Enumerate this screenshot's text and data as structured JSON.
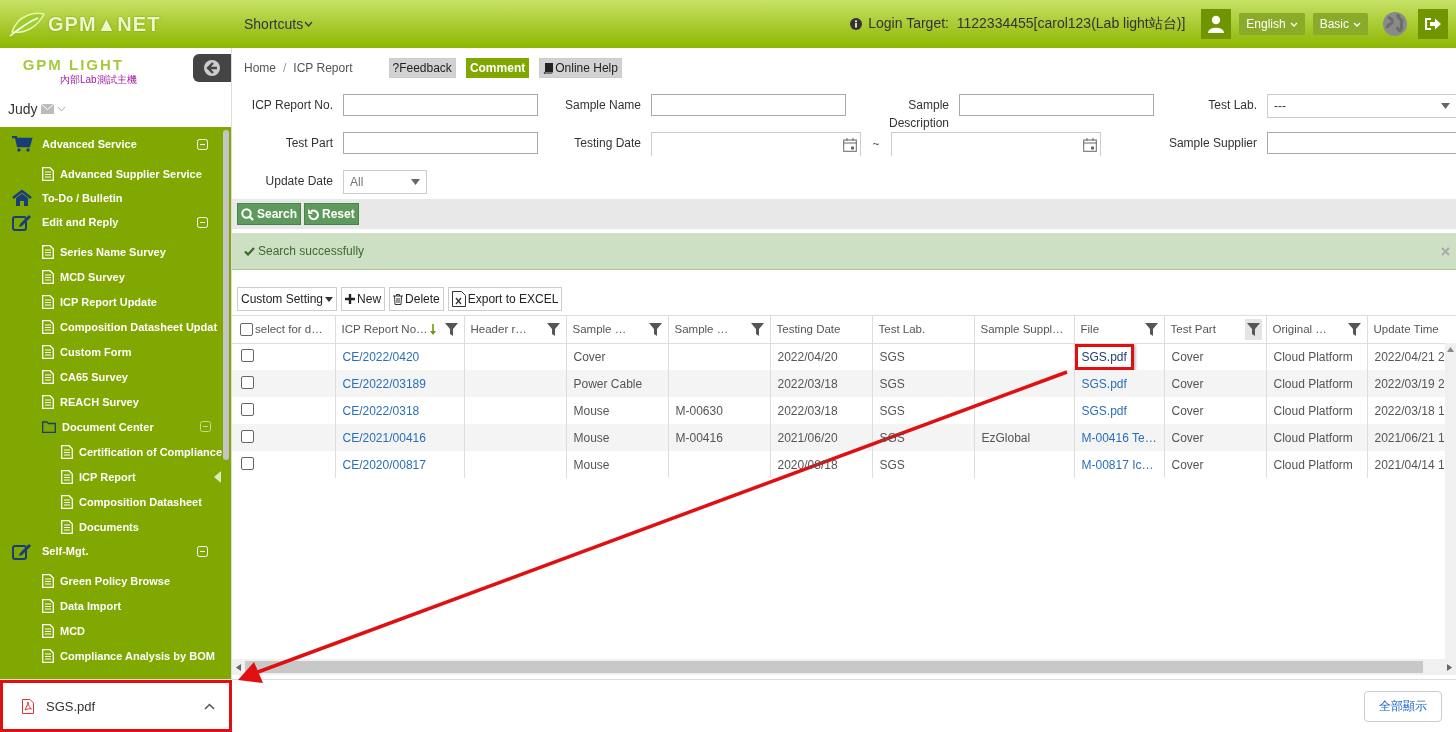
{
  "header": {
    "logo": "GPM▲NET",
    "shortcuts": "Shortcuts",
    "login_target": "Login Target:  1122334455[carol123(Lab light站台)]",
    "language": "English",
    "mode": "Basic"
  },
  "sidebar": {
    "logo": "GPM LIGHT",
    "logo_subtitle": "內部Lab測試主機",
    "user": "Judy",
    "items": [
      {
        "label": "Advanced Service",
        "kind": "section",
        "expanded": true,
        "children": [
          {
            "label": "Advanced Supplier Service",
            "kind": "page",
            "selected": false
          }
        ]
      },
      {
        "label": "To-Do / Bulletin",
        "kind": "section"
      },
      {
        "label": "Edit and Reply",
        "kind": "section",
        "expanded": true,
        "children": [
          {
            "label": "Series Name Survey",
            "kind": "page",
            "selected": false
          },
          {
            "label": "MCD Survey",
            "kind": "page",
            "selected": false
          },
          {
            "label": "ICP Report Update",
            "kind": "page",
            "selected": false
          },
          {
            "label": "Composition Datasheet Updat",
            "kind": "page",
            "selected": false
          },
          {
            "label": "Custom Form",
            "kind": "page",
            "selected": false
          },
          {
            "label": "CA65 Survey",
            "kind": "page",
            "selected": false
          },
          {
            "label": "REACH Survey",
            "kind": "page",
            "selected": false
          },
          {
            "label": "Document Center",
            "kind": "folder",
            "expanded": true,
            "children": [
              {
                "label": "Certification of Compliance",
                "kind": "page",
                "selected": false
              },
              {
                "label": "ICP Report",
                "kind": "page",
                "selected": true
              },
              {
                "label": "Composition Datasheet",
                "kind": "page",
                "selected": false
              },
              {
                "label": "Documents",
                "kind": "page",
                "selected": false
              }
            ]
          }
        ]
      },
      {
        "label": "Self-Mgt.",
        "kind": "section",
        "expanded": true,
        "children": [
          {
            "label": "Green Policy Browse",
            "kind": "page",
            "selected": false
          },
          {
            "label": "Data Import",
            "kind": "page",
            "selected": false
          },
          {
            "label": "MCD",
            "kind": "page",
            "selected": false
          },
          {
            "label": "Compliance Analysis by BOM",
            "kind": "page",
            "selected": false
          }
        ]
      }
    ]
  },
  "breadcrumb": {
    "items": [
      "Home",
      "ICP Report"
    ],
    "separator": "/"
  },
  "help_buttons": [
    {
      "label": "?Feedback",
      "kind": "plain"
    },
    {
      "label": "Comment",
      "kind": "primary"
    },
    {
      "label": "Online Help",
      "kind": "book"
    }
  ],
  "filters": [
    {
      "label": "ICP Report No.",
      "kind": "text"
    },
    {
      "label": "Sample Name",
      "kind": "text"
    },
    {
      "label": "Sample Description",
      "kind": "text"
    },
    {
      "label": "Test Lab.",
      "kind": "select",
      "value": "---"
    },
    {
      "label": "Test Part",
      "kind": "text"
    },
    {
      "label": "Testing Date",
      "kind": "date_range",
      "separator": "~"
    },
    {
      "label": "Sample Supplier",
      "kind": "text"
    },
    {
      "label": "Update Date",
      "kind": "select",
      "value": "All"
    }
  ],
  "actions": [
    "Search",
    "Reset"
  ],
  "alert": "Search successfully",
  "table_toolbar": {
    "custom": "Custom Setting",
    "new": "New",
    "delete": "Delete",
    "export": "Export to EXCEL"
  },
  "table": {
    "select_column": {
      "label": "select for d…",
      "checked": false
    },
    "columns": [
      {
        "label": "ICP Report No…",
        "filter": true,
        "filter_active": false,
        "sorted": true
      },
      {
        "label": "Header r…",
        "filter": true,
        "filter_active": false
      },
      {
        "label": "Sample …",
        "filter": true,
        "filter_active": false
      },
      {
        "label": "Sample …",
        "filter": true,
        "filter_active": false
      },
      {
        "label": "Testing Date",
        "filter": false
      },
      {
        "label": "Test Lab.",
        "filter": false
      },
      {
        "label": "Sample Suppl…",
        "filter": false
      },
      {
        "label": "File",
        "filter": true,
        "filter_active": false
      },
      {
        "label": "Test Part",
        "filter": true,
        "filter_active": true
      },
      {
        "label": "Original …",
        "filter": true,
        "filter_active": false
      },
      {
        "label": "Update Time",
        "filter": false
      }
    ],
    "rows": [
      {
        "checked": false,
        "file_highlighted": true,
        "cells": [
          "CE/2022/0420",
          "",
          "Cover",
          "",
          "2022/04/20",
          "SGS",
          "",
          "SGS.pdf",
          "Cover",
          "Cloud Platform",
          "2022/04/21 2"
        ]
      },
      {
        "checked": false,
        "file_highlighted": false,
        "cells": [
          "CE/2022/03189",
          "",
          "Power Cable",
          "",
          "2022/03/18",
          "SGS",
          "",
          "SGS.pdf",
          "Cover",
          "Cloud Platform",
          "2022/03/19 2"
        ]
      },
      {
        "checked": false,
        "file_highlighted": false,
        "cells": [
          "CE/2022/0318",
          "",
          "Mouse",
          "M-00630",
          "2022/03/18",
          "SGS",
          "",
          "SGS.pdf",
          "Cover",
          "Cloud Platform",
          "2022/03/18 1"
        ]
      },
      {
        "checked": false,
        "file_highlighted": false,
        "cells": [
          "CE/2021/00416",
          "",
          "Mouse",
          "M-00416",
          "2021/06/20",
          "SGS",
          "EzGlobal",
          "M-00416 Te…",
          "Cover",
          "Cloud Platform",
          "2021/06/21 1"
        ]
      },
      {
        "checked": false,
        "file_highlighted": false,
        "cells": [
          "CE/2020/00817",
          "",
          "Mouse",
          "",
          "2020/08/18",
          "SGS",
          "",
          "M-00817 Ic…",
          "Cover",
          "Cloud Platform",
          "2021/04/14 1"
        ]
      }
    ]
  },
  "download_bar": {
    "file": "SGS.pdf",
    "highlighted": true,
    "show_all": "全部顯示"
  }
}
